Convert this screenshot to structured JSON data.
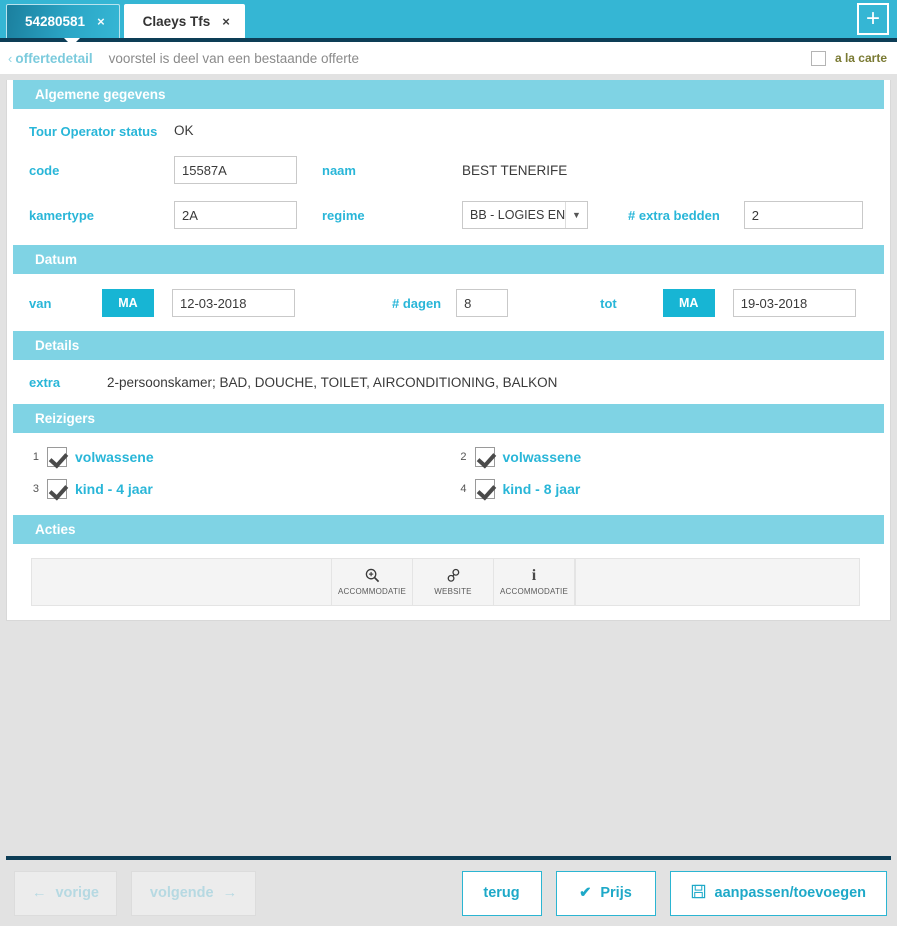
{
  "tabs": [
    {
      "label": "54280581",
      "close": "×",
      "active": false
    },
    {
      "label": "Claeys Tfs",
      "close": "×",
      "active": true
    }
  ],
  "tabbar": {
    "add_label": "+"
  },
  "breadcrumb": {
    "back_arrow": "‹",
    "link": "offertedetail",
    "text": "voorstel is deel van een bestaande offerte"
  },
  "alacarte": {
    "label": "a la carte",
    "checked": false
  },
  "sections": {
    "algemene": {
      "title": "Algemene gegevens",
      "tour_operator_status_label": "Tour Operator status",
      "tour_operator_status_value": "OK",
      "code_label": "code",
      "code_value": "15587A",
      "naam_label": "naam",
      "naam_value": "BEST TENERIFE",
      "kamertype_label": "kamertype",
      "kamertype_value": "2A",
      "regime_label": "regime",
      "regime_value": "BB - LOGIES EN",
      "extra_bedden_label": "# extra bedden",
      "extra_bedden_value": "2"
    },
    "datum": {
      "title": "Datum",
      "van_label": "van",
      "van_day": "MA",
      "van_date": "12-03-2018",
      "dagen_label": "# dagen",
      "dagen_value": "8",
      "tot_label": "tot",
      "tot_day": "MA",
      "tot_date": "19-03-2018"
    },
    "details": {
      "title": "Details",
      "extra_label": "extra",
      "extra_value": "2-persoonskamer; BAD, DOUCHE, TOILET, AIRCONDITIONING, BALKON"
    },
    "reizigers": {
      "title": "Reizigers",
      "items": [
        {
          "num": "1",
          "label": "volwassene",
          "checked": true
        },
        {
          "num": "2",
          "label": "volwassene",
          "checked": true
        },
        {
          "num": "3",
          "label": "kind - 4 jaar",
          "checked": true
        },
        {
          "num": "4",
          "label": "kind - 8 jaar",
          "checked": true
        }
      ]
    },
    "acties": {
      "title": "Acties",
      "buttons": [
        {
          "icon": "zoom-in-icon",
          "glyph": "⊕",
          "label": "ACCOMMODATIE"
        },
        {
          "icon": "link-icon",
          "glyph": "⚭",
          "label": "WEBSITE"
        },
        {
          "icon": "info-icon",
          "glyph": "i",
          "label": "ACCOMMODATIE"
        }
      ]
    }
  },
  "footer": {
    "vorige": "vorige",
    "vorige_arrow": "←",
    "volgende": "volgende",
    "volgende_arrow": "→",
    "terug": "terug",
    "prijs": "Prijs",
    "prijs_check": "✔",
    "aanpassen": "aanpassen/toevoegen",
    "save_glyph": "Ὃe"
  },
  "colors": {
    "tabbar": "#35b6d4",
    "section_header": "#7fd3e4",
    "label": "#29b6d8",
    "accent": "#17b5d4",
    "footer_rule": "#0d3d56",
    "alacarte": "#7a7a33"
  }
}
